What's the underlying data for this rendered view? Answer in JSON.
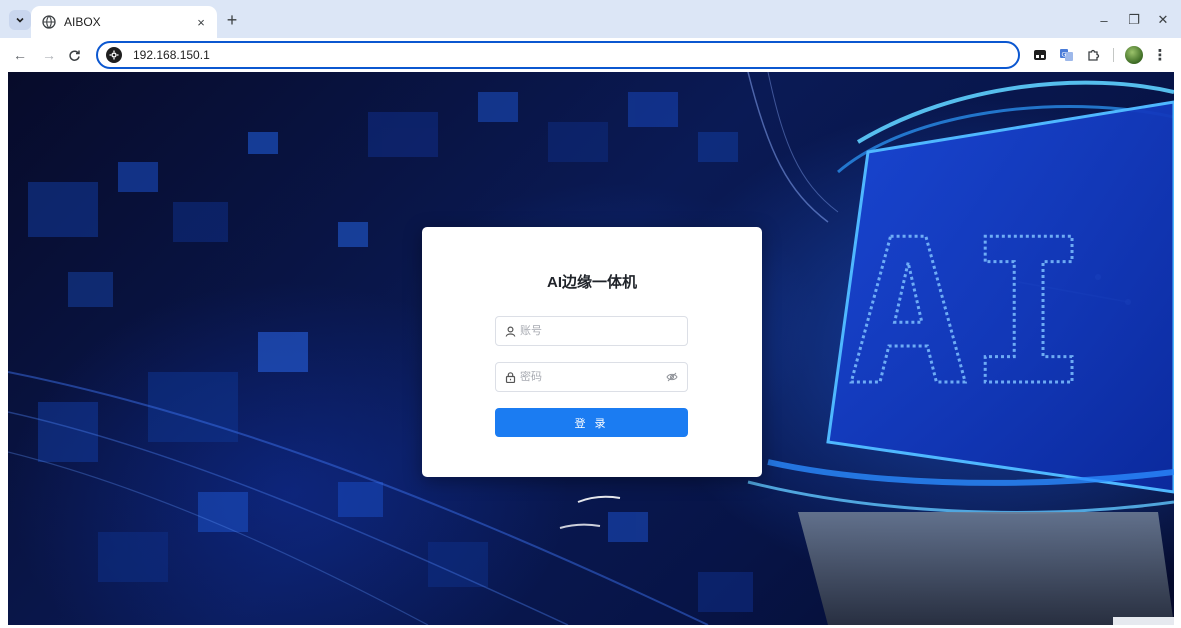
{
  "browser": {
    "tab_title": "AIBOX",
    "new_tab_symbol": "+",
    "close_tab_symbol": "×",
    "url": "192.168.150.1",
    "window_controls": {
      "minimize": "–",
      "restore": "❐",
      "close": "✕"
    },
    "menu_symbol": "⋮",
    "nav": {
      "back": "←",
      "forward": "→",
      "reload": "C"
    }
  },
  "login": {
    "title": "AI边缘一体机",
    "username_placeholder": "账号",
    "password_placeholder": "密码",
    "submit_label": "登 录"
  },
  "background": {
    "hero_text": "AI",
    "accent_color": "#1b7cf2",
    "glow_color": "#3fa0ff"
  },
  "icons": {
    "tab_search": "chevron-down-icon",
    "favicon": "globe-icon",
    "site_info": "site-settings-icon",
    "ext1": "extension-card-icon",
    "ext2": "translate-icon",
    "ext3": "puzzle-icon",
    "user": "user-icon",
    "lock": "lock-icon",
    "eye": "eye-off-icon"
  }
}
